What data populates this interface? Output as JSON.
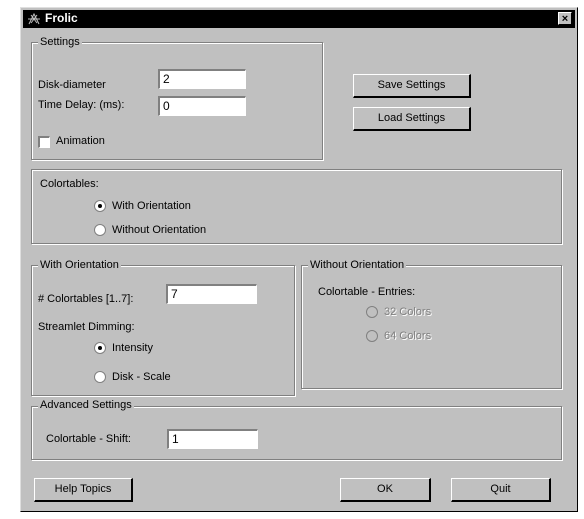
{
  "window": {
    "title": "Frolic",
    "close_label": "×"
  },
  "settings": {
    "group_label": "Settings",
    "disk_diameter_label": "Disk-diameter",
    "disk_diameter_value": "2",
    "time_delay_label": "Time Delay: (ms):",
    "time_delay_value": "0",
    "animation_label": "Animation",
    "animation_checked": false,
    "save_label": "Save Settings",
    "load_label": "Load Settings"
  },
  "colortables": {
    "group_label": "Colortables:",
    "with_label": "With Orientation",
    "without_label": "Without Orientation",
    "selected": "with"
  },
  "with_orientation": {
    "group_label": "With Orientation",
    "count_label": "# Colortables [1..7]:",
    "count_value": "7",
    "dimming_label": "Streamlet Dimming:",
    "intensity_label": "Intensity",
    "disk_scale_label": "Disk - Scale",
    "selected": "intensity"
  },
  "without_orientation": {
    "group_label": "Without Orientation",
    "entries_label": "Colortable - Entries:",
    "option1_label": "32 Colors",
    "option2_label": "64 Colors"
  },
  "advanced": {
    "group_label": "Advanced Settings",
    "shift_label": "Colortable - Shift:",
    "shift_value": "1"
  },
  "footer": {
    "help_label": "Help Topics",
    "ok_label": "OK",
    "quit_label": "Quit"
  }
}
